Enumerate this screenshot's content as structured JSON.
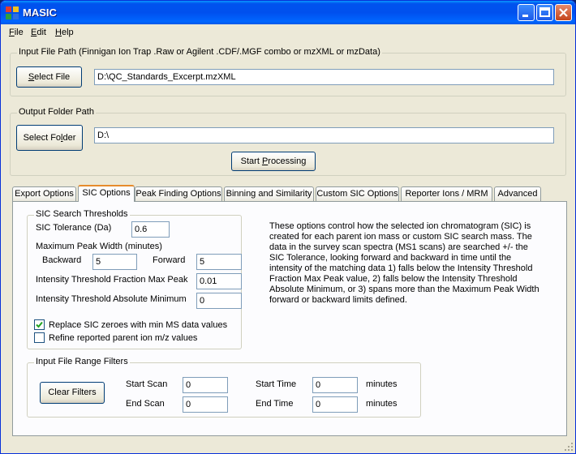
{
  "window": {
    "title": "MASIC"
  },
  "menu": [
    {
      "label": "File",
      "accel": "F",
      "rest": "ile"
    },
    {
      "label": "Edit",
      "accel": "E",
      "rest": "dit"
    },
    {
      "label": "Help",
      "accel": "H",
      "rest": "elp"
    }
  ],
  "input": {
    "group_label": "Input File Path (Finnigan Ion Trap .Raw or Agilent .CDF/.MGF combo or mzXML or mzData)",
    "button_accel": "S",
    "button_rest": "elect File",
    "path": "D:\\QC_Standards_Excerpt.mzXML"
  },
  "output": {
    "group_label": "Output Folder Path",
    "button_pre": "Select Fo",
    "button_accel": "l",
    "button_post": "der",
    "path": "D:\\"
  },
  "start": {
    "pre": "Start ",
    "accel": "P",
    "post": "rocessing"
  },
  "tabs": [
    "Export Options",
    "SIC Options",
    "Peak Finding Options",
    "Binning and Similarity",
    "Custom SIC Options",
    "Reporter Ions / MRM",
    "Advanced"
  ],
  "active_tab": "SIC Options",
  "sic": {
    "group_label": "SIC Search Thresholds",
    "tolerance_label": "SIC Tolerance (Da)",
    "tolerance_value": "0.6",
    "max_width_label": "Maximum Peak Width (minutes)",
    "backward_label": "Backward",
    "backward_value": "5",
    "forward_label": "Forward",
    "forward_value": "5",
    "fraction_label": "Intensity Threshold Fraction Max Peak",
    "fraction_value": "0.01",
    "absolute_label": "Intensity Threshold Absolute Minimum",
    "absolute_value": "0",
    "replace_zeroes_label": "Replace SIC zeroes with min MS data values",
    "replace_zeroes_checked": true,
    "refine_label": "Refine reported parent ion m/z values",
    "refine_checked": false
  },
  "description": "These options control how the selected ion chromatogram (SIC) is created for each parent ion mass or custom SIC search mass. The data in the survey scan spectra (MS1 scans) are searched +/- the SIC Tolerance, looking forward and backward in time until the intensity of the matching data 1) falls below the Intensity Threshold Fraction Max Peak value, 2) falls below the Intensity Threshold Absolute Minimum, or 3) spans more than the Maximum Peak Width forward or backward limits defined.",
  "range": {
    "group_label": "Input File Range Filters",
    "clear_label": "Clear Filters",
    "start_scan_label": "Start Scan",
    "start_scan_value": "0",
    "end_scan_label": "End Scan",
    "end_scan_value": "0",
    "start_time_label": "Start Time",
    "start_time_value": "0",
    "end_time_label": "End Time",
    "end_time_value": "0",
    "minutes_label": "minutes"
  },
  "colors": {
    "title_bar": "#0054e3",
    "window_bg": "#ece9d8",
    "tab_accent": "#e68b2c",
    "check_mark": "#21a121"
  }
}
